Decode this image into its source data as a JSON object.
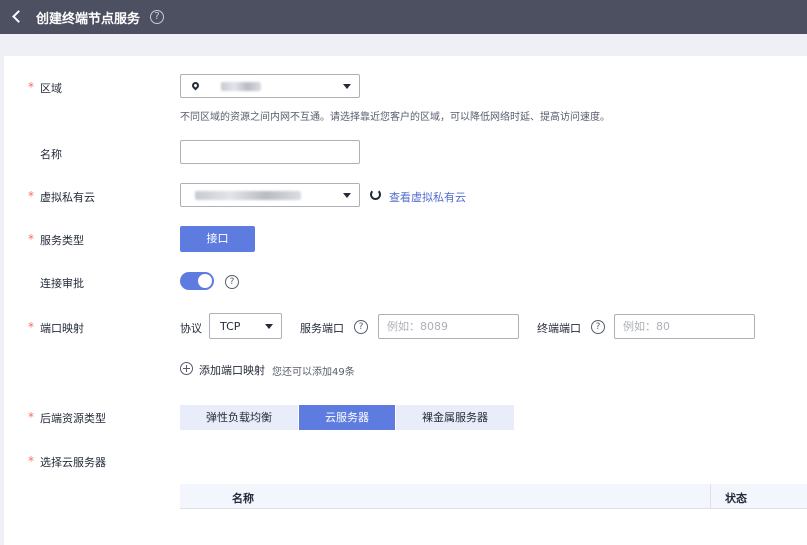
{
  "header": {
    "title": "创建终端节点服务",
    "help": "?"
  },
  "form": {
    "region": {
      "label": "区域",
      "required": "*",
      "hint": "不同区域的资源之间内网不互通。请选择靠近您客户的区域，可以降低网络时延、提高访问速度。"
    },
    "name": {
      "label": "名称",
      "value": ""
    },
    "vpc": {
      "label": "虚拟私有云",
      "required": "*",
      "link": "查看虚拟私有云"
    },
    "service_type": {
      "label": "服务类型",
      "required": "*",
      "button": "接口"
    },
    "approval": {
      "label": "连接审批",
      "enabled": true,
      "help": "?"
    },
    "port_mapping": {
      "label": "端口映射",
      "required": "*",
      "protocol_label": "协议",
      "protocol_value": "TCP",
      "service_port_label": "服务端口",
      "service_port_placeholder": "例如：8089",
      "terminal_port_label": "终端端口",
      "terminal_port_placeholder": "例如：80",
      "add_link": "添加端口映射",
      "remaining_hint": "您还可以添加49条"
    },
    "backend_type": {
      "label": "后端资源类型",
      "required": "*",
      "options": [
        "弹性负载均衡",
        "云服务器",
        "裸金属服务器"
      ],
      "selected": "云服务器"
    },
    "select_server": {
      "label": "选择云服务器",
      "required": "*",
      "columns": [
        "名称",
        "状态"
      ]
    }
  },
  "colors": {
    "accent": "#5e7ce0",
    "required": "#f66f6a",
    "topbar": "#4c5060"
  }
}
